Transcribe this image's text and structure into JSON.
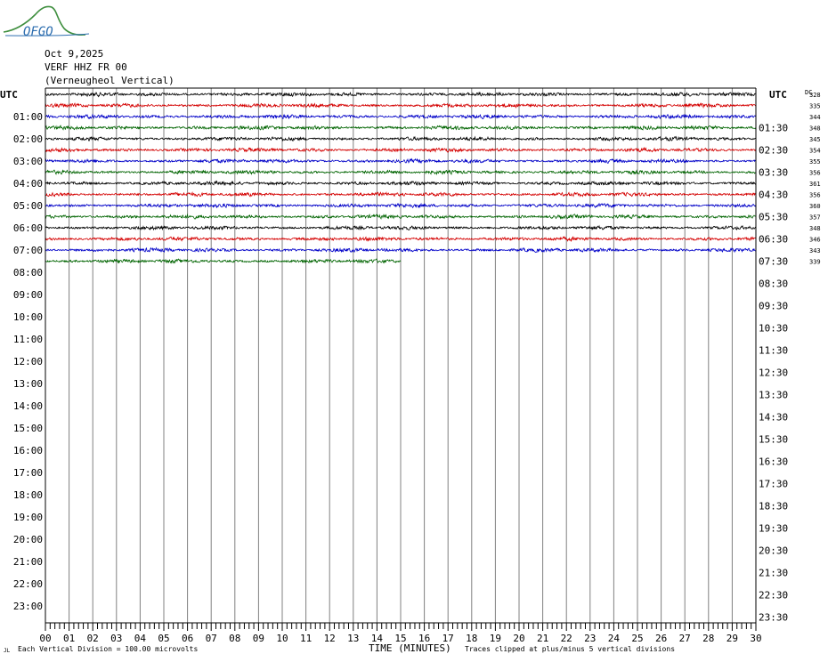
{
  "logo": {
    "text": "OFGO",
    "color": "#2f6fb0",
    "wave_color": "#3f8f3f"
  },
  "header": {
    "date": "Oct 9,2025",
    "station": "VERF HHZ FR 00",
    "location": "(Verneugheol Vertical)"
  },
  "chart_data": {
    "type": "line",
    "subtype": "helicorder",
    "left_axis_title": "UTC",
    "right_axis_title": "UTC",
    "dc_title": "DC",
    "left_labels": [
      "01:00",
      "02:00",
      "03:00",
      "04:00",
      "05:00",
      "06:00",
      "07:00",
      "08:00",
      "09:00",
      "10:00",
      "11:00",
      "12:00",
      "13:00",
      "14:00",
      "15:00",
      "16:00",
      "17:00",
      "18:00",
      "19:00",
      "20:00",
      "21:00",
      "22:00",
      "23:00"
    ],
    "right_labels": [
      "01:30",
      "02:30",
      "03:30",
      "04:30",
      "05:30",
      "06:30",
      "07:30",
      "08:30",
      "09:30",
      "10:30",
      "11:30",
      "12:30",
      "13:30",
      "14:30",
      "15:30",
      "16:30",
      "17:30",
      "18:30",
      "19:30",
      "20:30",
      "21:30",
      "22:30",
      "23:30"
    ],
    "dc_offsets": [
      "328",
      "335",
      "344",
      "348",
      "345",
      "354",
      "355",
      "356",
      "361",
      "356",
      "360",
      "357",
      "348",
      "346",
      "343",
      "339"
    ],
    "x_ticks": [
      "00",
      "01",
      "02",
      "03",
      "04",
      "05",
      "06",
      "07",
      "08",
      "09",
      "10",
      "11",
      "12",
      "13",
      "14",
      "15",
      "16",
      "17",
      "18",
      "19",
      "20",
      "21",
      "22",
      "23",
      "24",
      "25",
      "26",
      "27",
      "28",
      "29",
      "30"
    ],
    "xlim": [
      0,
      30
    ],
    "rows_total": 48,
    "minutes_per_row": 30,
    "trace_colors": [
      "#000000",
      "#d40000",
      "#0000c8",
      "#006400"
    ],
    "trace_rows": [
      {
        "start": "00:00",
        "duration_min": 30,
        "color": "#000000"
      },
      {
        "start": "00:30",
        "duration_min": 30,
        "color": "#d40000"
      },
      {
        "start": "01:00",
        "duration_min": 30,
        "color": "#0000c8"
      },
      {
        "start": "01:30",
        "duration_min": 30,
        "color": "#006400"
      },
      {
        "start": "02:00",
        "duration_min": 30,
        "color": "#000000"
      },
      {
        "start": "02:30",
        "duration_min": 30,
        "color": "#d40000"
      },
      {
        "start": "03:00",
        "duration_min": 30,
        "color": "#0000c8"
      },
      {
        "start": "03:30",
        "duration_min": 30,
        "color": "#006400"
      },
      {
        "start": "04:00",
        "duration_min": 30,
        "color": "#000000"
      },
      {
        "start": "04:30",
        "duration_min": 30,
        "color": "#d40000"
      },
      {
        "start": "05:00",
        "duration_min": 30,
        "color": "#0000c8"
      },
      {
        "start": "05:30",
        "duration_min": 30,
        "color": "#006400"
      },
      {
        "start": "06:00",
        "duration_min": 30,
        "color": "#000000"
      },
      {
        "start": "06:30",
        "duration_min": 30,
        "color": "#d40000"
      },
      {
        "start": "07:00",
        "duration_min": 30,
        "color": "#0000c8"
      },
      {
        "start": "07:30",
        "duration_min": 15,
        "color": "#006400"
      }
    ],
    "xlabel": "TIME (MINUTES)",
    "scale_note": "Each Vertical Division =  100.00 microvolts",
    "clip_note": "Traces clipped at plus/minus 5 vertical divisions",
    "grid": true
  }
}
